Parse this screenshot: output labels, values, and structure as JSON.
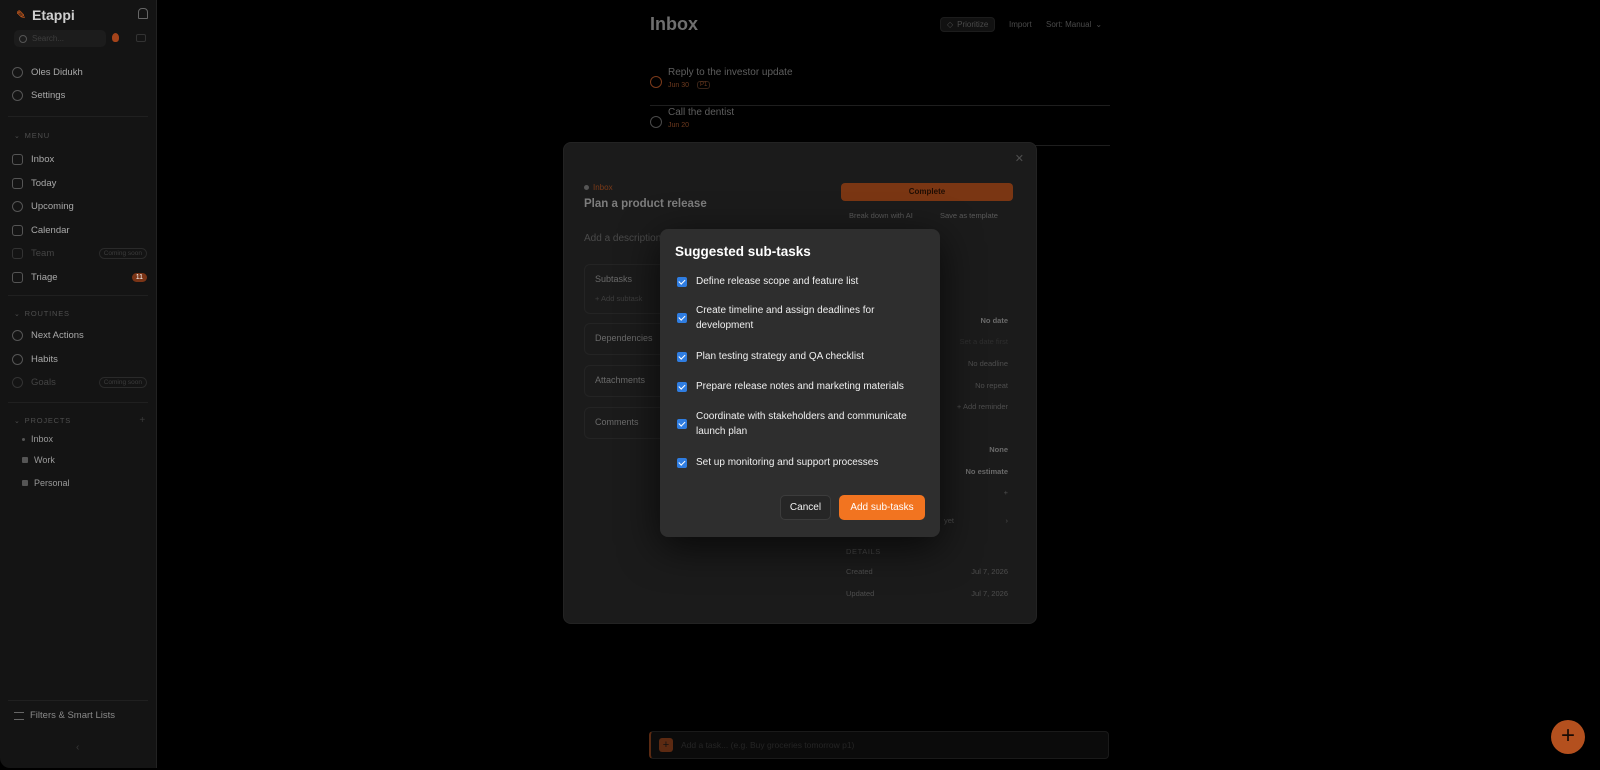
{
  "app": {
    "name": "Etappi"
  },
  "sidebar": {
    "search_placeholder": "Search...",
    "user": "Oles Didukh",
    "settings": "Settings",
    "menu_header": "MENU",
    "menu": [
      {
        "label": "Inbox"
      },
      {
        "label": "Today"
      },
      {
        "label": "Upcoming"
      },
      {
        "label": "Calendar"
      },
      {
        "label": "Team",
        "badge": "Coming soon"
      },
      {
        "label": "Triage",
        "count": "11"
      }
    ],
    "routines_header": "ROUTINES",
    "routines": [
      {
        "label": "Next Actions"
      },
      {
        "label": "Habits"
      },
      {
        "label": "Goals",
        "badge": "Coming soon"
      }
    ],
    "projects_header": "PROJECTS",
    "projects": [
      {
        "label": "Inbox"
      },
      {
        "label": "Work"
      },
      {
        "label": "Personal"
      }
    ],
    "filters": "Filters & Smart Lists"
  },
  "main": {
    "title": "Inbox",
    "prioritize": "Prioritize",
    "import": "Import",
    "sort": "Sort: Manual",
    "tasks": [
      {
        "title": "Reply to the investor update",
        "due": "Jun 30",
        "tag": "P1"
      },
      {
        "title": "Call the dentist",
        "due": "Jun 20"
      }
    ],
    "quick_add_placeholder": "Add a task... (e.g. Buy groceries tomorrow p1)"
  },
  "detail": {
    "project": "Inbox",
    "title": "Plan a product release",
    "description_placeholder": "Add a description...",
    "complete": "Complete",
    "break_down": "Break down with AI",
    "save_template": "Save as template",
    "sections": {
      "subtasks": "Subtasks",
      "add_subtask": "+ Add subtask",
      "dependencies": "Dependencies",
      "attachments": "Attachments",
      "comments": "Comments"
    },
    "props": {
      "date": "No date",
      "date_hint": "Set a date first",
      "deadline": "No deadline",
      "repeat": "No repeat",
      "reminder": "+ Add reminder",
      "priority": "None",
      "estimate": "No estimate",
      "activity_tail": "yet"
    },
    "details_header": "DETAILS",
    "created_label": "Created",
    "created_value": "Jul 7, 2026",
    "updated_label": "Updated",
    "updated_value": "Jul 7, 2026"
  },
  "dialog": {
    "title": "Suggested sub-tasks",
    "items": [
      {
        "text": "Define release scope and feature list",
        "checked": true
      },
      {
        "text": "Create timeline and assign deadlines for development",
        "checked": true
      },
      {
        "text": "Plan testing strategy and QA checklist",
        "checked": true
      },
      {
        "text": "Prepare release notes and marketing materials",
        "checked": true
      },
      {
        "text": "Coordinate with stakeholders and communicate launch plan",
        "checked": true
      },
      {
        "text": "Set up monitoring and support processes",
        "checked": true
      }
    ],
    "cancel": "Cancel",
    "add": "Add sub-tasks"
  },
  "colors": {
    "accent": "#f27420",
    "checkbox": "#2f7de1",
    "dialog_bg": "#2e2e2e"
  }
}
